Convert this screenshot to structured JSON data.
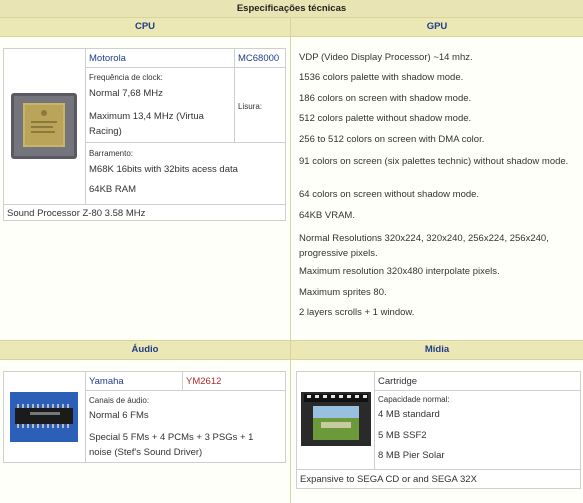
{
  "title": "Especificações técnicas",
  "sections": {
    "cpu": "CPU",
    "gpu": "GPU",
    "audio": "Áudio",
    "midia": "Mídia"
  },
  "cpu": {
    "brand": "Motorola",
    "model": "MC68000",
    "clock_label": "Frequência de clock:",
    "clock_normal": "Normal 7,68 MHz",
    "clock_max": "Maximum 13,4 MHz (Virtua Racing)",
    "lisura_label": "Lisura:",
    "bus_label": "Barramento:",
    "bus_value": "M68K 16bits with 32bits acess data",
    "ram": "64KB RAM",
    "sound_processor": "Sound Processor Z-80 3.58 MHz"
  },
  "gpu": {
    "lines": [
      "VDP (Video Display Processor) ~14 mhz.",
      "1536 colors palette with shadow mode.",
      "186 colors on screen with shadow mode.",
      "512 colors palette without shadow mode.",
      "256 to 512 colors on screen with DMA color.",
      "91 colors on screen (six palettes technic) without shadow mode.",
      "64 colors on screen without shadow mode.",
      "64KB VRAM.",
      "Normal Resolutions 320x224, 320x240, 256x224, 256x240, progressive pixels.",
      "Maximum resolution 320x480 interpolate pixels.",
      "Maximum sprites 80.",
      "2 layers scrolls + 1 window."
    ]
  },
  "audio": {
    "brand": "Yamaha",
    "model": "YM2612",
    "channels_label": "Canais de áudio:",
    "normal": "Normal 6 FMs",
    "special": "Special 5 FMs + 4 PCMs + 3 PSGs + 1 noise (Stef's Sound Driver)"
  },
  "midia": {
    "type": "Cartridge",
    "capacity_label": "Capacidade normal:",
    "capacities": [
      "4 MB standard",
      "5 MB SSF2",
      "8 MB Pier Solar"
    ],
    "expansion": "Expansive to SEGA CD or and SEGA 32X"
  }
}
